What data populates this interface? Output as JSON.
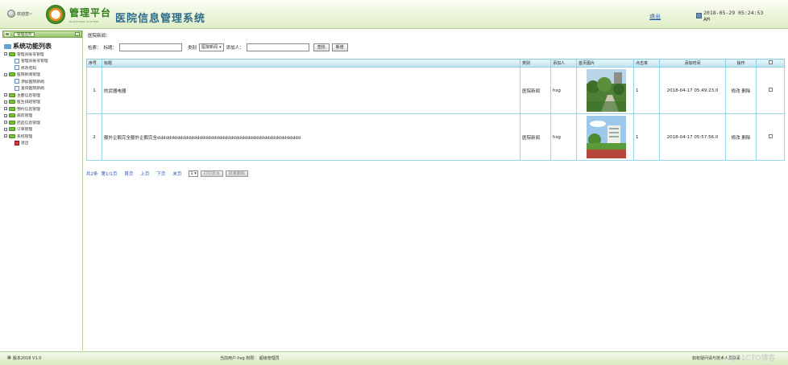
{
  "header": {
    "welcome": "欢迎您~",
    "logo_text": "管理平台",
    "logo_sub": "PLATFORM SYSTEM",
    "system_title": "医院信息管理系统",
    "logout": "退出",
    "datetime": "2018-05-29 05:24:53",
    "ampm": "AM"
  },
  "sidebar": {
    "manage_button": "管理选项",
    "collapse": "«",
    "root_label": "系统功能列表",
    "items": [
      {
        "label": "管理员账号管理",
        "level": 0
      },
      {
        "label": "管理员账号管理",
        "level": 1
      },
      {
        "label": "修改密码",
        "level": 1
      },
      {
        "label": "医院新闻管理",
        "level": 0
      },
      {
        "label": "添加医院新闻",
        "level": 1
      },
      {
        "label": "查询医院新闻",
        "level": 1
      },
      {
        "label": "主都信息管理",
        "level": 0
      },
      {
        "label": "医生排班管理",
        "level": 0
      },
      {
        "label": "预约信息管理",
        "level": 0
      },
      {
        "label": "病房管理",
        "level": 0
      },
      {
        "label": "药品信息管理",
        "level": 0
      },
      {
        "label": "订单管理",
        "level": 0
      },
      {
        "label": "系统管理",
        "level": 0
      },
      {
        "label": "退出",
        "level": 1
      }
    ]
  },
  "main": {
    "breadcrumb": "医院新闻：",
    "search": {
      "label": "检索：",
      "title_label": "标题：",
      "title_value": "",
      "category_label": "类别",
      "category_value": "医院新闻",
      "adder_label": "添加人：",
      "adder_value": "",
      "search_button": "查找",
      "add_button": "新增"
    },
    "table": {
      "headers": [
        "序号",
        "标题",
        "类别",
        "添加人",
        "首页图片",
        "点击率",
        "添加时间",
        "操作",
        ""
      ],
      "rows": [
        {
          "no": "1",
          "title": "的武器电器",
          "category": "医院新闻",
          "adder": "hsg",
          "clicks": "1",
          "time": "2018-04-17 05:49:23.0",
          "edit": "修改",
          "delete": "删除"
        },
        {
          "no": "2",
          "title": "额外企鹅完全额外企鹅完全ddddddddddddddddddddddddddddddddddddddddddddddddddd",
          "category": "医院新闻",
          "adder": "hsg",
          "clicks": "1",
          "time": "2018-04-17 05:57:56.0",
          "edit": "修改",
          "delete": "删除"
        }
      ]
    },
    "pager": {
      "total": "共2条",
      "page": "第1/1页",
      "first": "首页",
      "prev": "上页",
      "next": "下页",
      "last": "末页",
      "page_select": "1",
      "print_button": "打印本页",
      "batch_delete_button": "批量删除"
    }
  },
  "footer": {
    "version": "版本2018 V1.0",
    "current_user": "当前用户:hsg  权限： 超级管理员",
    "tip": "如有疑问请与技术人员联系",
    "watermark": "@51CTO博客"
  },
  "colors": {
    "brand_green": "#2f7d16",
    "title_blue": "#2e6c8a",
    "table_border": "#9ad7ea",
    "link_blue": "#2a56b0"
  }
}
